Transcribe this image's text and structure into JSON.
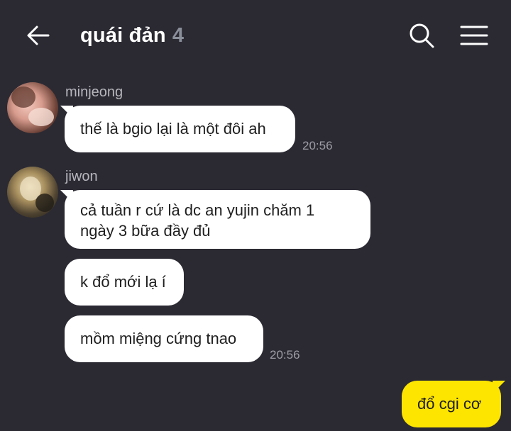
{
  "chat": {
    "title": "quái đản",
    "member_count": "4"
  },
  "messages": [
    {
      "sender": "minjeong",
      "bubbles": [
        "thế là bgio lại là một đôi ah"
      ],
      "time": "20:56"
    },
    {
      "sender": "jiwon",
      "bubbles": [
        [
          "cả tuần r cứ là dc an yujin chăm 1",
          "ngày 3 bữa đầy đủ"
        ],
        "k đổ mới lạ í",
        "mồm miệng cứng tnao"
      ],
      "time": "20:56"
    },
    {
      "sender": "me",
      "bubbles": [
        "đổ cgi cơ"
      ]
    }
  ],
  "colors": {
    "background": "#2b2a33",
    "incoming_bubble": "#ffffff",
    "outgoing_bubble": "#fee500",
    "count_text": "#8a8f9a"
  },
  "icons": {
    "back": "arrow-left",
    "search": "magnifier",
    "menu": "hamburger"
  }
}
